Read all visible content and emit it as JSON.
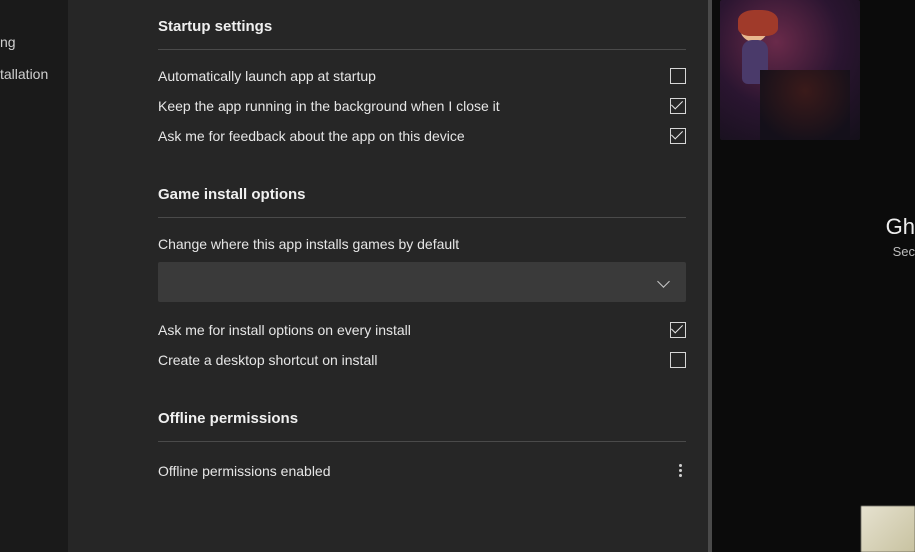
{
  "sidebar": {
    "items": [
      {
        "label": "ng"
      },
      {
        "label": "tallation"
      }
    ]
  },
  "sections": {
    "startup": {
      "title": "Startup settings",
      "rows": [
        {
          "label": "Automatically launch app at startup",
          "checked": false
        },
        {
          "label": "Keep the app running in the background when I close it",
          "checked": true
        },
        {
          "label": "Ask me for feedback about the app on this device",
          "checked": true
        }
      ]
    },
    "install": {
      "title": "Game install options",
      "change_label": "Change where this app installs games by default",
      "select_value": "",
      "rows": [
        {
          "label": "Ask me for install options on every install",
          "checked": true
        },
        {
          "label": "Create a desktop shortcut on install",
          "checked": false
        }
      ]
    },
    "offline": {
      "title": "Offline permissions",
      "status": "Offline permissions enabled"
    }
  },
  "promo": {
    "title_partial": "Gh",
    "subtitle_partial": "Sec"
  }
}
